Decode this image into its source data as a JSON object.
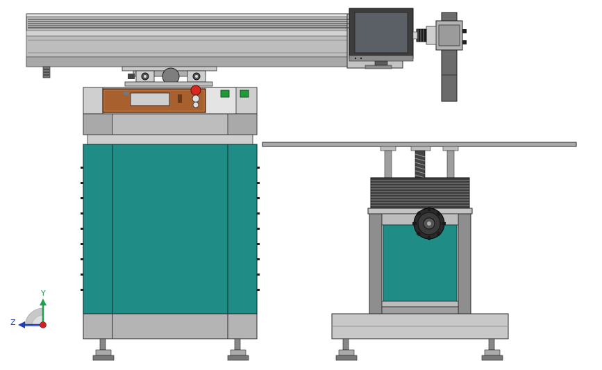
{
  "colors": {
    "background": "#ffffff",
    "teal_panel": "#1f8c86",
    "teal_panel_dark": "#157770",
    "steel_light": "#d9d9d9",
    "steel_mid": "#a9a9a9",
    "steel_dark": "#6b6b6b",
    "outline": "#2a2a2a",
    "control_panel_brown": "#a8602e",
    "monitor_screen": "#5b5f66",
    "green_button": "#1e9a3a",
    "red_button": "#d9281f",
    "bellows": "#3c3c3c",
    "axis_y": "#1aa34a",
    "axis_z": "#1f3fb8",
    "axis_origin": "#d42020"
  },
  "axis_triad": {
    "y_label": "Y",
    "z_label": "Z"
  },
  "icons": {
    "triad": "coordinate-triad-icon",
    "handwheel": "handwheel-icon"
  }
}
